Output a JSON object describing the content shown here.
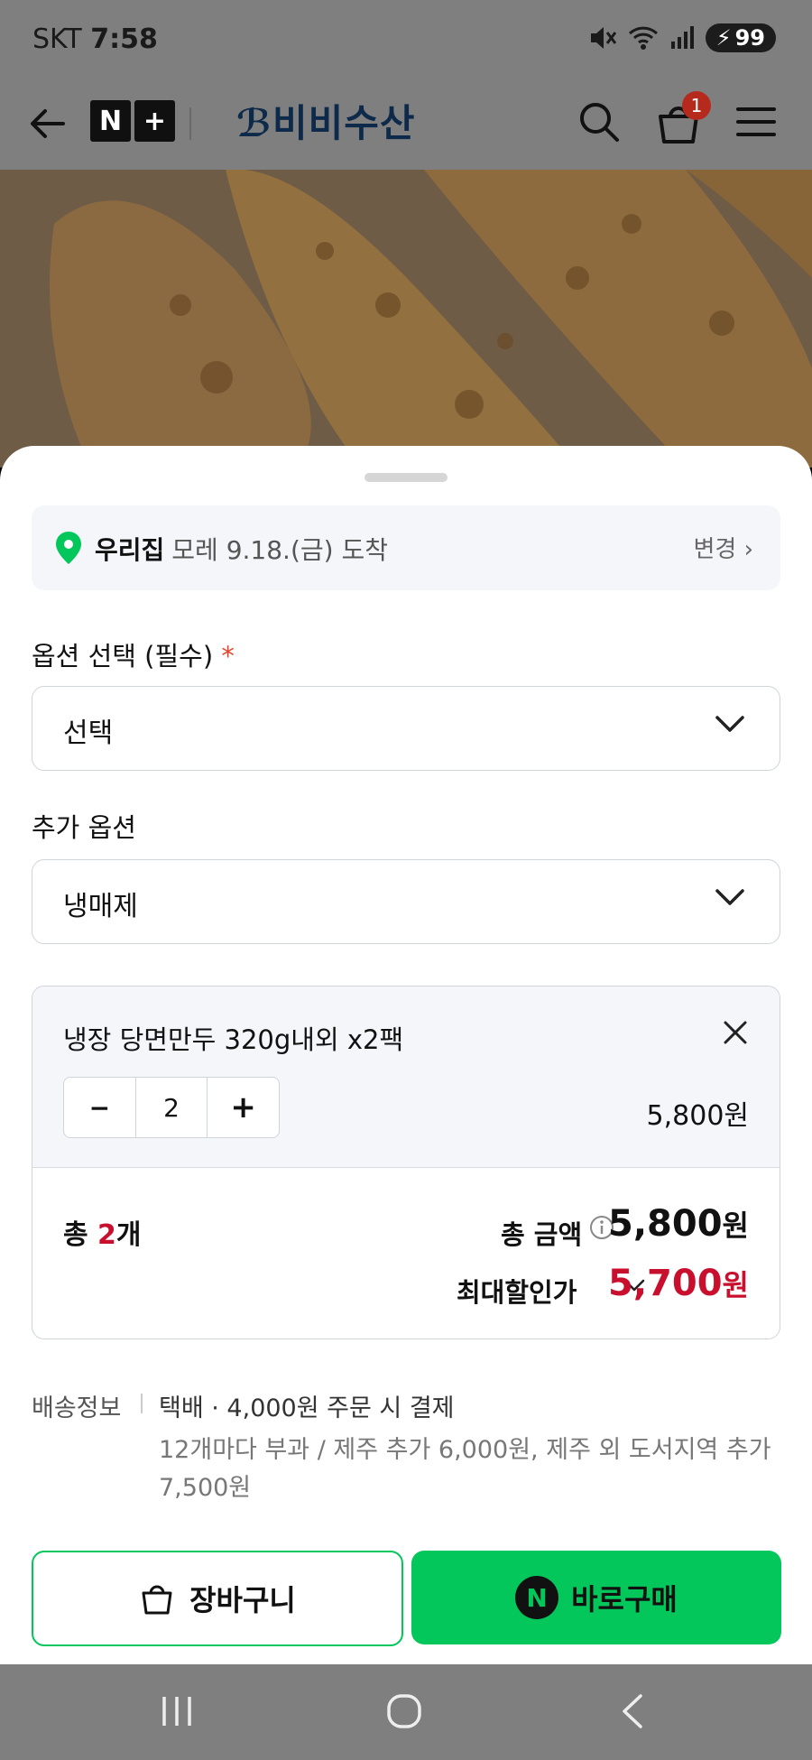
{
  "status": {
    "carrier": "SKT",
    "time": "7:58",
    "battery": "99"
  },
  "header": {
    "brand": "비비수산",
    "nplus_left": "N",
    "nplus_right": "+",
    "cart_count": "1"
  },
  "delivery": {
    "place": "우리집",
    "eta": "모레 9.18.(금) 도착",
    "change": "변경 ›"
  },
  "options": {
    "required_label": "옵션 선택 (필수)",
    "required_star": "*",
    "required_value": "선택",
    "extra_label": "추가 옵션",
    "extra_value": "냉매제"
  },
  "item": {
    "name": "냉장 당면만두 320g내외 x2팩",
    "qty": "2",
    "minus": "−",
    "plus": "+",
    "price": "5,800원"
  },
  "totals": {
    "count_prefix": "총 ",
    "count": "2",
    "count_suffix": "개",
    "amount_label": "총 금액",
    "amount": "5,800",
    "won": "원",
    "max_label": "최대할인가",
    "max_amount": "5,700"
  },
  "shipping": {
    "label": "배송정보",
    "main": "택배 · 4,000원 주문 시 결제",
    "sub": "12개마다 부과 / 제주 추가 6,000원, 제주 외 도서지역 추가 7,500원"
  },
  "buttons": {
    "cart": "장바구니",
    "buy": "바로구매",
    "buy_badge": "N"
  },
  "colors": {
    "green": "#03c75a",
    "red": "#c8102e",
    "brand": "#0e2a4a"
  }
}
